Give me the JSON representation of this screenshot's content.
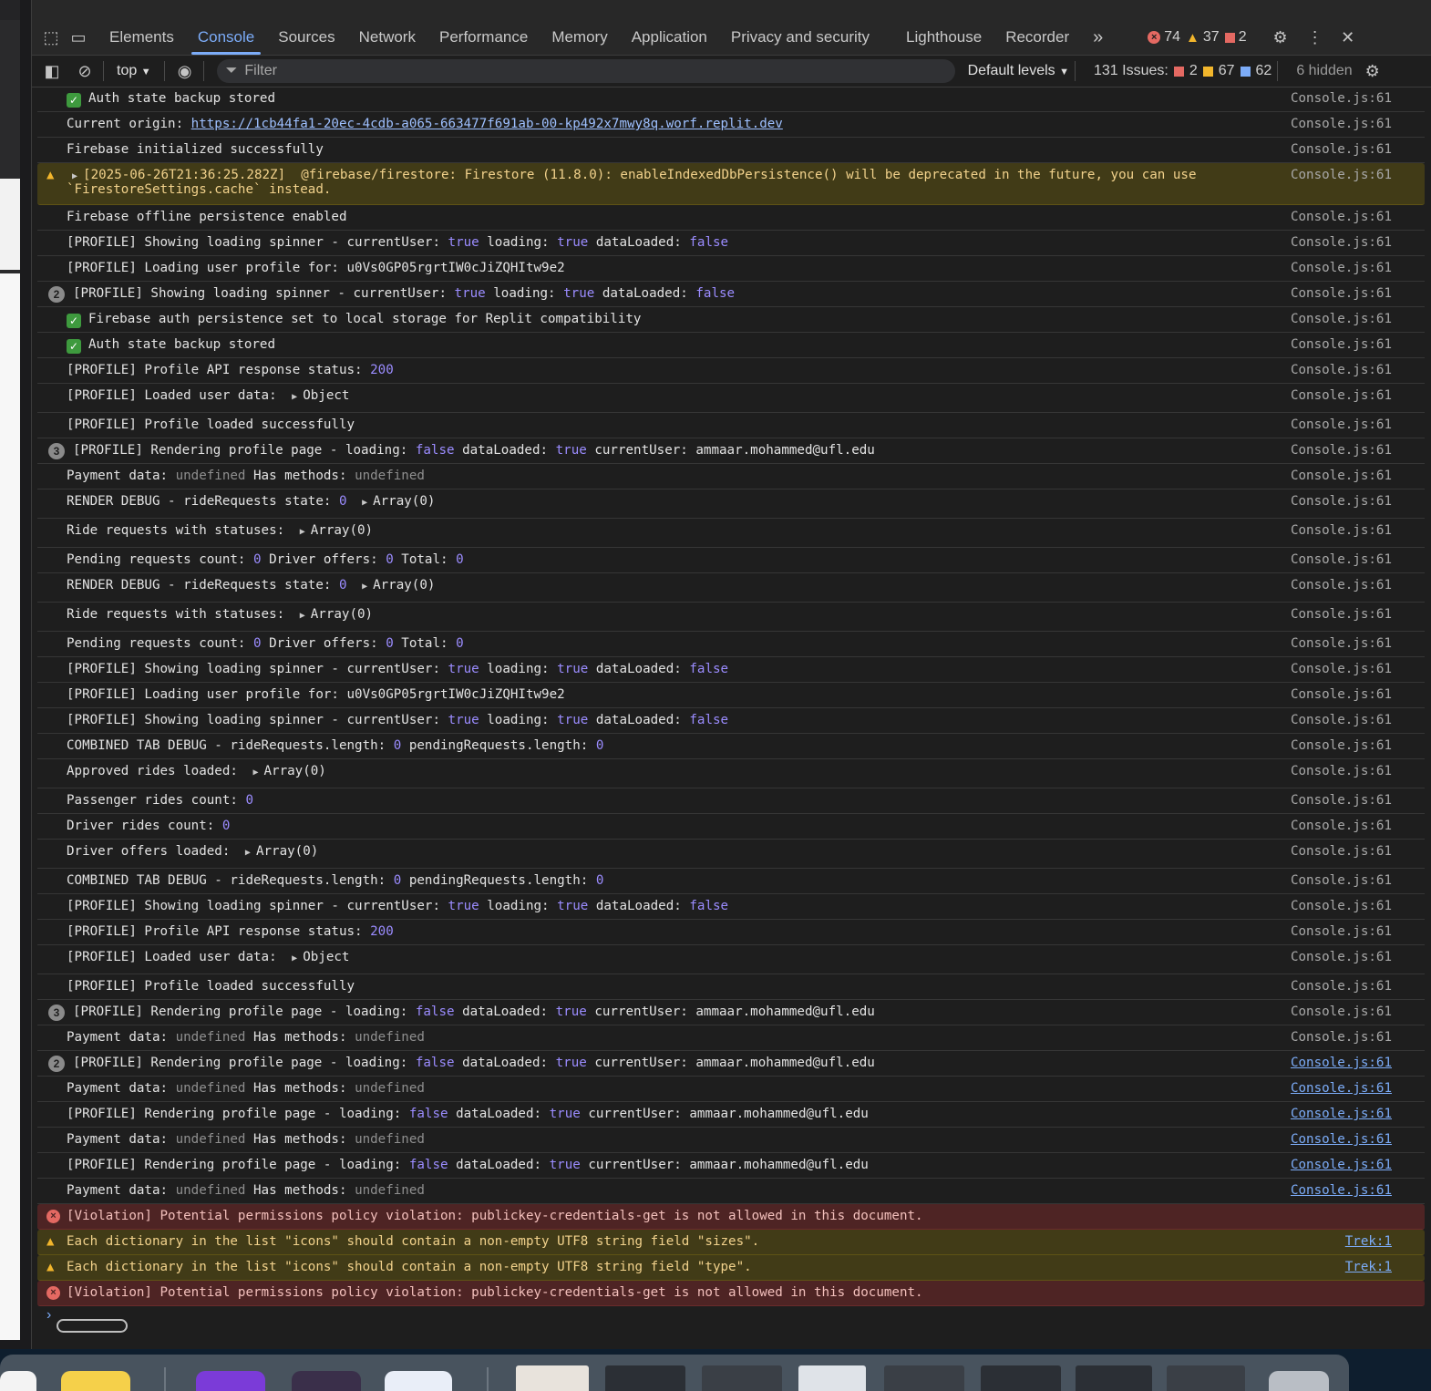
{
  "tabs": [
    "Elements",
    "Console",
    "Sources",
    "Network",
    "Performance",
    "Memory",
    "Application",
    "Privacy and security",
    "Lighthouse",
    "Recorder"
  ],
  "active_tab": "Console",
  "counters": {
    "errors": "74",
    "warnings": "37",
    "issues": "2"
  },
  "toolbar": {
    "context": "top",
    "filter_placeholder": "Filter",
    "levels": "Default levels",
    "issues_label": "131 Issues:",
    "issues_err": "2",
    "issues_warn": "67",
    "issues_info": "62",
    "hidden": "6 hidden"
  },
  "source_default": "Console.js:61",
  "source_trek": "Trek:1",
  "messages": [
    {
      "segs": [
        [
          "check",
          ""
        ],
        [
          "t",
          "Auth state backup stored"
        ]
      ]
    },
    {
      "segs": [
        [
          "t",
          "Current origin: "
        ],
        [
          "url",
          "https://1cb44fa1-20ec-4cdb-a065-663477f691ab-00-kp492x7mwy8q.worf.replit.dev"
        ]
      ]
    },
    {
      "segs": [
        [
          "t",
          "Firebase initialized successfully"
        ]
      ]
    },
    {
      "level": "warn",
      "tall": true,
      "segs": [
        [
          "tri",
          ""
        ],
        [
          "t",
          "[2025-06-26T21:36:25.282Z]  @firebase/firestore: Firestore (11.8.0): enableIndexedDbPersistence() will be deprecated in the future, you can use\n`FirestoreSettings.cache` instead."
        ]
      ]
    },
    {
      "segs": [
        [
          "t",
          "Firebase offline persistence enabled"
        ]
      ]
    },
    {
      "segs": [
        [
          "t",
          "[PROFILE] Showing loading spinner - currentUser: "
        ],
        [
          "b",
          "true"
        ],
        [
          "t",
          " loading: "
        ],
        [
          "b",
          "true"
        ],
        [
          "t",
          " dataLoaded: "
        ],
        [
          "b",
          "false"
        ]
      ]
    },
    {
      "segs": [
        [
          "t",
          "[PROFILE] Loading user profile for: u0Vs0GP05rgrtIW0cJiZQHItw9e2"
        ]
      ]
    },
    {
      "count": "2",
      "segs": [
        [
          "t",
          "[PROFILE] Showing loading spinner - currentUser: "
        ],
        [
          "b",
          "true"
        ],
        [
          "t",
          " loading: "
        ],
        [
          "b",
          "true"
        ],
        [
          "t",
          " dataLoaded: "
        ],
        [
          "b",
          "false"
        ]
      ]
    },
    {
      "segs": [
        [
          "check",
          ""
        ],
        [
          "t",
          "Firebase auth persistence set to local storage for Replit compatibility"
        ]
      ]
    },
    {
      "segs": [
        [
          "check",
          ""
        ],
        [
          "t",
          "Auth state backup stored"
        ]
      ]
    },
    {
      "segs": [
        [
          "t",
          "[PROFILE] Profile API response status: "
        ],
        [
          "n",
          "200"
        ]
      ]
    },
    {
      "obj": true,
      "segs": [
        [
          "t",
          "[PROFILE] Loaded user data: "
        ],
        [
          "tri",
          ""
        ],
        [
          "t",
          "Object"
        ]
      ]
    },
    {
      "segs": [
        [
          "t",
          "[PROFILE] Profile loaded successfully"
        ]
      ]
    },
    {
      "count": "3",
      "segs": [
        [
          "t",
          "[PROFILE] Rendering profile page - loading: "
        ],
        [
          "b",
          "false"
        ],
        [
          "t",
          " dataLoaded: "
        ],
        [
          "b",
          "true"
        ],
        [
          "t",
          " currentUser: ammaar.mohammed@ufl.edu"
        ]
      ]
    },
    {
      "segs": [
        [
          "t",
          "Payment data: "
        ],
        [
          "u",
          "undefined"
        ],
        [
          "t",
          " Has methods: "
        ],
        [
          "u",
          "undefined"
        ]
      ]
    },
    {
      "obj": true,
      "segs": [
        [
          "t",
          "RENDER DEBUG - rideRequests state: "
        ],
        [
          "n",
          "0"
        ],
        [
          "t",
          " "
        ],
        [
          "tri",
          ""
        ],
        [
          "t",
          "Array(0)"
        ]
      ]
    },
    {
      "obj": true,
      "segs": [
        [
          "t",
          "Ride requests with statuses: "
        ],
        [
          "tri",
          ""
        ],
        [
          "t",
          "Array(0)"
        ]
      ]
    },
    {
      "segs": [
        [
          "t",
          "Pending requests count: "
        ],
        [
          "n",
          "0"
        ],
        [
          "t",
          " Driver offers: "
        ],
        [
          "n",
          "0"
        ],
        [
          "t",
          " Total: "
        ],
        [
          "n",
          "0"
        ]
      ]
    },
    {
      "obj": true,
      "segs": [
        [
          "t",
          "RENDER DEBUG - rideRequests state: "
        ],
        [
          "n",
          "0"
        ],
        [
          "t",
          " "
        ],
        [
          "tri",
          ""
        ],
        [
          "t",
          "Array(0)"
        ]
      ]
    },
    {
      "obj": true,
      "segs": [
        [
          "t",
          "Ride requests with statuses: "
        ],
        [
          "tri",
          ""
        ],
        [
          "t",
          "Array(0)"
        ]
      ]
    },
    {
      "segs": [
        [
          "t",
          "Pending requests count: "
        ],
        [
          "n",
          "0"
        ],
        [
          "t",
          " Driver offers: "
        ],
        [
          "n",
          "0"
        ],
        [
          "t",
          " Total: "
        ],
        [
          "n",
          "0"
        ]
      ]
    },
    {
      "segs": [
        [
          "t",
          "[PROFILE] Showing loading spinner - currentUser: "
        ],
        [
          "b",
          "true"
        ],
        [
          "t",
          " loading: "
        ],
        [
          "b",
          "true"
        ],
        [
          "t",
          " dataLoaded: "
        ],
        [
          "b",
          "false"
        ]
      ]
    },
    {
      "segs": [
        [
          "t",
          "[PROFILE] Loading user profile for: u0Vs0GP05rgrtIW0cJiZQHItw9e2"
        ]
      ]
    },
    {
      "segs": [
        [
          "t",
          "[PROFILE] Showing loading spinner - currentUser: "
        ],
        [
          "b",
          "true"
        ],
        [
          "t",
          " loading: "
        ],
        [
          "b",
          "true"
        ],
        [
          "t",
          " dataLoaded: "
        ],
        [
          "b",
          "false"
        ]
      ]
    },
    {
      "segs": [
        [
          "t",
          "COMBINED TAB DEBUG - rideRequests.length: "
        ],
        [
          "n",
          "0"
        ],
        [
          "t",
          " pendingRequests.length: "
        ],
        [
          "n",
          "0"
        ]
      ]
    },
    {
      "obj": true,
      "segs": [
        [
          "t",
          "Approved rides loaded: "
        ],
        [
          "tri",
          ""
        ],
        [
          "t",
          "Array(0)"
        ]
      ]
    },
    {
      "segs": [
        [
          "t",
          "Passenger rides count: "
        ],
        [
          "n",
          "0"
        ]
      ]
    },
    {
      "segs": [
        [
          "t",
          "Driver rides count: "
        ],
        [
          "n",
          "0"
        ]
      ]
    },
    {
      "obj": true,
      "segs": [
        [
          "t",
          "Driver offers loaded: "
        ],
        [
          "tri",
          ""
        ],
        [
          "t",
          "Array(0)"
        ]
      ]
    },
    {
      "segs": [
        [
          "t",
          "COMBINED TAB DEBUG - rideRequests.length: "
        ],
        [
          "n",
          "0"
        ],
        [
          "t",
          " pendingRequests.length: "
        ],
        [
          "n",
          "0"
        ]
      ]
    },
    {
      "segs": [
        [
          "t",
          "[PROFILE] Showing loading spinner - currentUser: "
        ],
        [
          "b",
          "true"
        ],
        [
          "t",
          " loading: "
        ],
        [
          "b",
          "true"
        ],
        [
          "t",
          " dataLoaded: "
        ],
        [
          "b",
          "false"
        ]
      ]
    },
    {
      "segs": [
        [
          "t",
          "[PROFILE] Profile API response status: "
        ],
        [
          "n",
          "200"
        ]
      ]
    },
    {
      "obj": true,
      "segs": [
        [
          "t",
          "[PROFILE] Loaded user data: "
        ],
        [
          "tri",
          ""
        ],
        [
          "t",
          "Object"
        ]
      ]
    },
    {
      "segs": [
        [
          "t",
          "[PROFILE] Profile loaded successfully"
        ]
      ]
    },
    {
      "count": "3",
      "segs": [
        [
          "t",
          "[PROFILE] Rendering profile page - loading: "
        ],
        [
          "b",
          "false"
        ],
        [
          "t",
          " dataLoaded: "
        ],
        [
          "b",
          "true"
        ],
        [
          "t",
          " currentUser: ammaar.mohammed@ufl.edu"
        ]
      ]
    },
    {
      "segs": [
        [
          "t",
          "Payment data: "
        ],
        [
          "u",
          "undefined"
        ],
        [
          "t",
          " Has methods: "
        ],
        [
          "u",
          "undefined"
        ]
      ]
    },
    {
      "count": "2",
      "link": true,
      "segs": [
        [
          "t",
          "[PROFILE] Rendering profile page - loading: "
        ],
        [
          "b",
          "false"
        ],
        [
          "t",
          " dataLoaded: "
        ],
        [
          "b",
          "true"
        ],
        [
          "t",
          " currentUser: ammaar.mohammed@ufl.edu"
        ]
      ]
    },
    {
      "link": true,
      "segs": [
        [
          "t",
          "Payment data: "
        ],
        [
          "u",
          "undefined"
        ],
        [
          "t",
          " Has methods: "
        ],
        [
          "u",
          "undefined"
        ]
      ]
    },
    {
      "link": true,
      "segs": [
        [
          "t",
          "[PROFILE] Rendering profile page - loading: "
        ],
        [
          "b",
          "false"
        ],
        [
          "t",
          " dataLoaded: "
        ],
        [
          "b",
          "true"
        ],
        [
          "t",
          " currentUser: ammaar.mohammed@ufl.edu"
        ]
      ]
    },
    {
      "link": true,
      "segs": [
        [
          "t",
          "Payment data: "
        ],
        [
          "u",
          "undefined"
        ],
        [
          "t",
          " Has methods: "
        ],
        [
          "u",
          "undefined"
        ]
      ]
    },
    {
      "link": true,
      "segs": [
        [
          "t",
          "[PROFILE] Rendering profile page - loading: "
        ],
        [
          "b",
          "false"
        ],
        [
          "t",
          " dataLoaded: "
        ],
        [
          "b",
          "true"
        ],
        [
          "t",
          " currentUser: ammaar.mohammed@ufl.edu"
        ]
      ]
    },
    {
      "link": true,
      "segs": [
        [
          "t",
          "Payment data: "
        ],
        [
          "u",
          "undefined"
        ],
        [
          "t",
          " Has methods: "
        ],
        [
          "u",
          "undefined"
        ]
      ]
    },
    {
      "level": "error",
      "nosrc": true,
      "segs": [
        [
          "t",
          "[Violation] Potential permissions policy violation: publickey-credentials-get is not allowed in this document."
        ]
      ]
    },
    {
      "level": "warn",
      "trek": true,
      "segs": [
        [
          "t",
          "Each dictionary in the list \"icons\" should contain a non-empty UTF8 string field \"sizes\"."
        ]
      ]
    },
    {
      "level": "warn",
      "trek": true,
      "segs": [
        [
          "t",
          "Each dictionary in the list \"icons\" should contain a non-empty UTF8 string field \"type\"."
        ]
      ]
    },
    {
      "level": "error",
      "nosrc": true,
      "segs": [
        [
          "t",
          "[Violation] Potential permissions policy violation: publickey-credentials-get is not allowed in this document."
        ]
      ]
    }
  ],
  "prompt": "›"
}
